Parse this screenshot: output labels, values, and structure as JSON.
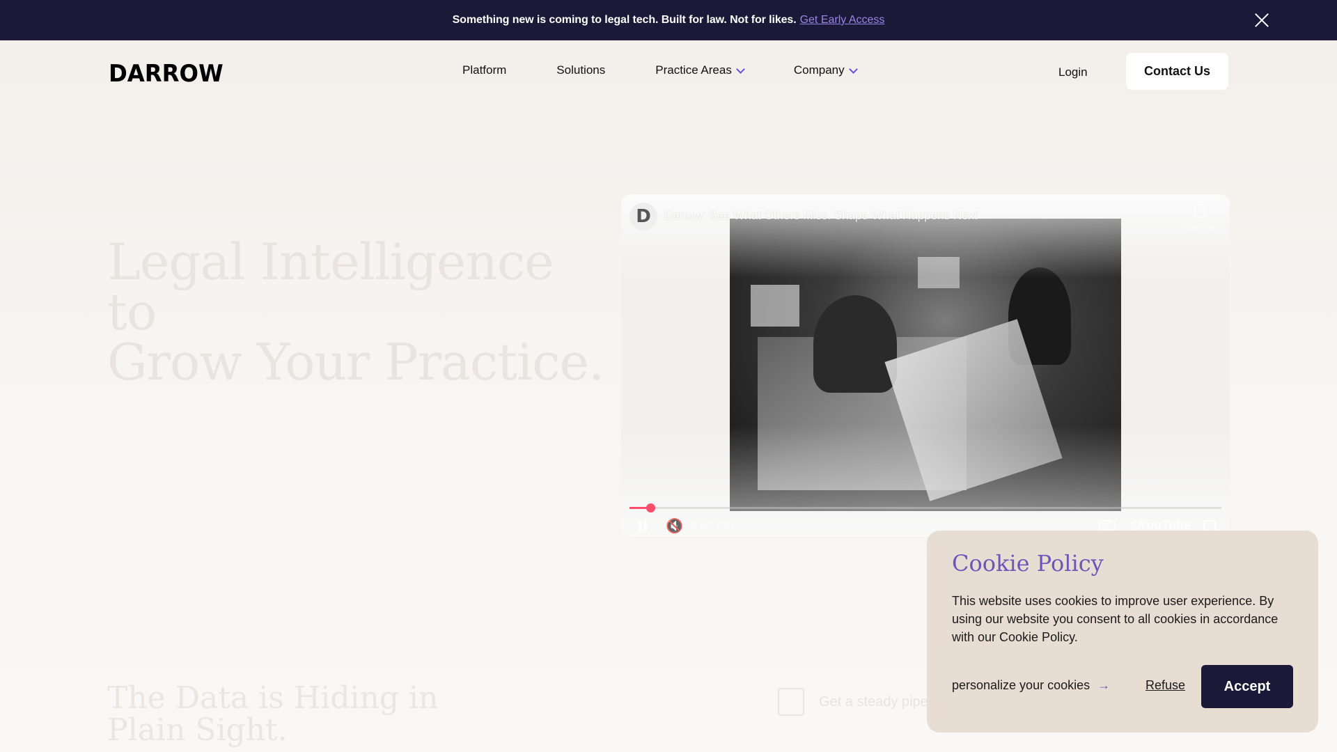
{
  "banner": {
    "message": "Something new is coming to legal tech. Built for law. Not for likes.",
    "link_label": "Get Early Access"
  },
  "nav": {
    "logo": "DARROW",
    "links": [
      "Platform",
      "Solutions",
      "Practice Areas",
      "Company"
    ],
    "login_label": "Login",
    "contact_label": "Contact Us"
  },
  "hero": {
    "title_line1": "Legal Intelligence to",
    "title_line2": "Grow Your Practice."
  },
  "video": {
    "channel_initial": "D",
    "title": "Darrow: See What Others Miss. Shape What Happens Next",
    "copy_label": "Copy link",
    "time": "0:18 / 1:28",
    "cc_label": "CC",
    "brand": "YouTube",
    "progress_fraction": 0.035,
    "progress_color": "#ff4e6b"
  },
  "section": {
    "title_line1": "The Data is Hiding in",
    "title_line2": "Plain Sight.",
    "faded_text": "Get a steady pipe"
  },
  "cookie": {
    "title": "Cookie Policy",
    "body": "This website uses cookies to improve user experience. By using our website you consent to all cookies in accordance with our Cookie Policy.",
    "personalize_label": "personalize your cookies",
    "personalize_arrow": "→",
    "refuse_label": "Refuse",
    "accept_label": "Accept"
  },
  "colors": {
    "banner_bg": "#1b1838",
    "accent_purple": "#6d55b9",
    "link_purple": "#9a86e6",
    "cookie_bg": "#e7ddd2"
  }
}
